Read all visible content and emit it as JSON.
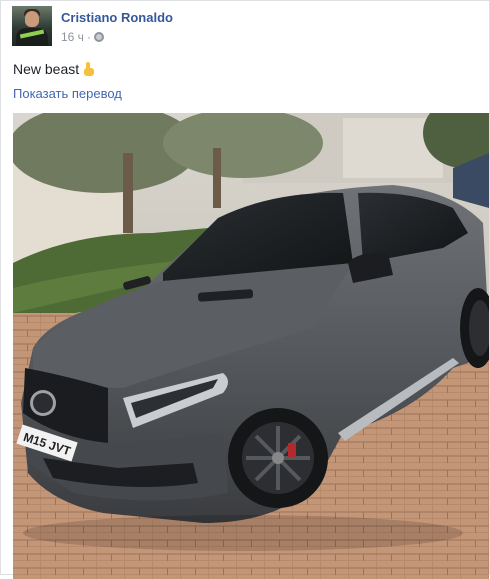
{
  "post": {
    "author": "Cristiano Ronaldo",
    "time": "16 ч",
    "separator": "·",
    "audience_icon": "globe-icon",
    "text": "New beast",
    "emoji": "pointing-hand-emoji",
    "translate_link": "Показать перевод",
    "photo": {
      "plate": "M15 JVT"
    }
  },
  "colors": {
    "link": "#365899",
    "translate": "#4267b2",
    "meta": "#90949c"
  }
}
